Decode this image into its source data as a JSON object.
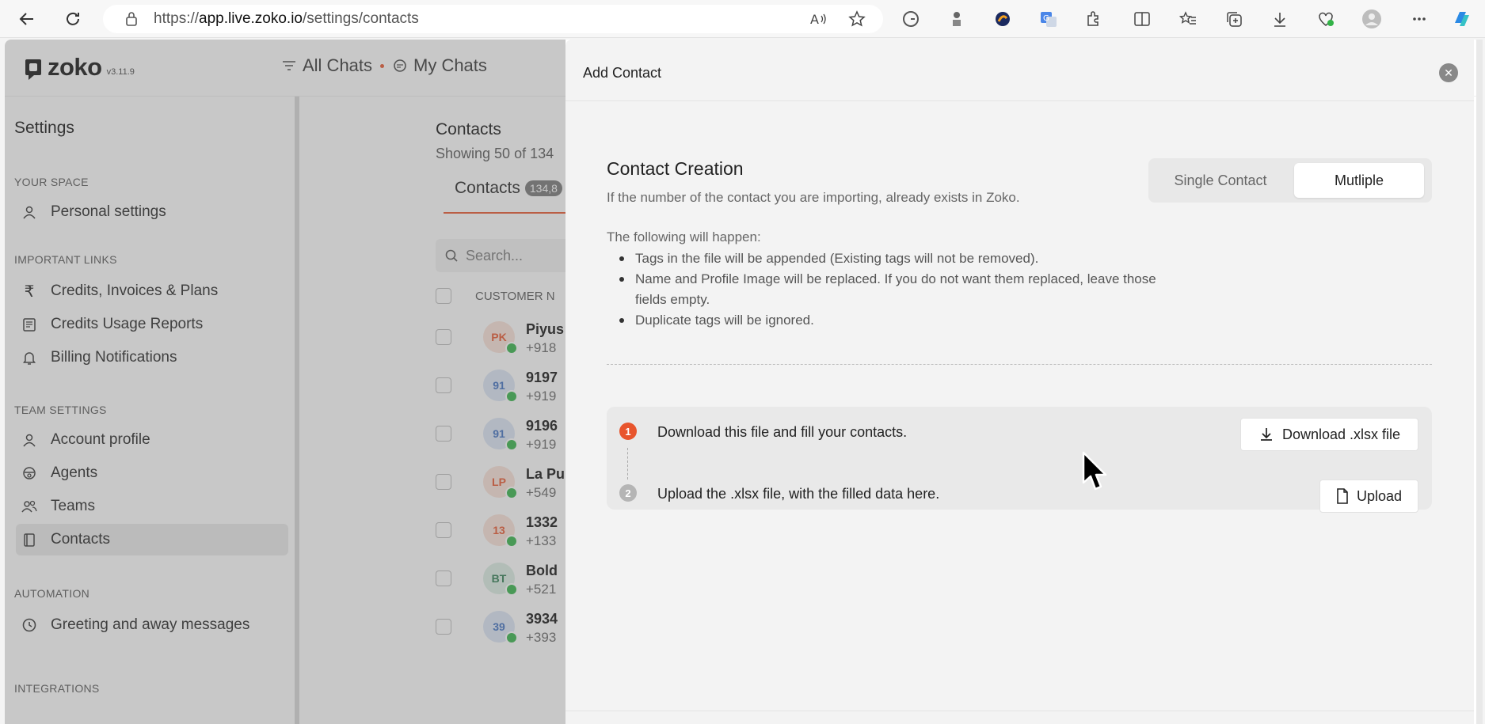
{
  "browser": {
    "url_prefix": "https://",
    "url_domain": "app.live.zoko.io",
    "url_path": "/settings/contacts"
  },
  "header": {
    "logo_text": "zoko",
    "version": "v3.11.9",
    "all_chats": "All Chats",
    "my_chats": "My Chats"
  },
  "sidebar": {
    "title": "Settings",
    "sections": [
      {
        "label": "YOUR SPACE",
        "items": [
          {
            "label": "Personal settings",
            "icon": "user-icon"
          }
        ]
      },
      {
        "label": "IMPORTANT LINKS",
        "items": [
          {
            "label": "Credits, Invoices & Plans",
            "icon": "rupee-icon"
          },
          {
            "label": "Credits Usage Reports",
            "icon": "report-icon"
          },
          {
            "label": "Billing Notifications",
            "icon": "bell-icon"
          }
        ]
      },
      {
        "label": "TEAM SETTINGS",
        "items": [
          {
            "label": "Account profile",
            "icon": "user-icon"
          },
          {
            "label": "Agents",
            "icon": "agent-icon"
          },
          {
            "label": "Teams",
            "icon": "team-icon"
          },
          {
            "label": "Contacts",
            "icon": "book-icon"
          }
        ]
      },
      {
        "label": "AUTOMATION",
        "items": [
          {
            "label": "Greeting and away messages",
            "icon": "clock-icon"
          }
        ]
      },
      {
        "label": "INTEGRATIONS",
        "items": []
      }
    ]
  },
  "contacts": {
    "title": "Contacts",
    "subtitle": "Showing 50 of 134",
    "tab_label": "Contacts",
    "tab_count": "134,8",
    "search_placeholder": "Search...",
    "col_header": "CUSTOMER N",
    "rows": [
      {
        "initials": "PK",
        "name": "Piyus",
        "phone": "+918",
        "bg": "#fbe3d8",
        "fg": "#e8552d"
      },
      {
        "initials": "91",
        "name": "9197",
        "phone": "+919",
        "bg": "#dce6f6",
        "fg": "#3d6fc1"
      },
      {
        "initials": "91",
        "name": "9196",
        "phone": "+919",
        "bg": "#dce6f6",
        "fg": "#3d6fc1"
      },
      {
        "initials": "LP",
        "name": "La Pu",
        "phone": "+549",
        "bg": "#fbe3d8",
        "fg": "#e8552d"
      },
      {
        "initials": "13",
        "name": "1332",
        "phone": "+133",
        "bg": "#fbe3d8",
        "fg": "#e8552d"
      },
      {
        "initials": "BT",
        "name": "Bold",
        "phone": "+521",
        "bg": "#dbeee4",
        "fg": "#2e7d51"
      },
      {
        "initials": "39",
        "name": "3934",
        "phone": "+393",
        "bg": "#dce6f6",
        "fg": "#3d6fc1"
      }
    ]
  },
  "modal": {
    "title": "Add Contact",
    "section_title": "Contact Creation",
    "section_subtitle": "If the number of the contact you are importing, already exists in Zoko.",
    "toggle_single": "Single Contact",
    "toggle_multiple": "Mutliple",
    "follow_title": "The following will happen:",
    "rules": [
      "Tags in the file will be appended (Existing tags will not be removed).",
      "Name and Profile Image will be replaced. If you do not want them replaced, leave those fields empty.",
      "Duplicate tags will be ignored."
    ],
    "step1_num": "1",
    "step1_text": "Download this file and fill your contacts.",
    "step1_button": "Download .xlsx file",
    "step2_num": "2",
    "step2_text": "Upload the .xlsx file, with the filled data here.",
    "step2_button": "Upload"
  },
  "colors": {
    "accent": "#e8552d",
    "whatsapp": "#33b348"
  }
}
